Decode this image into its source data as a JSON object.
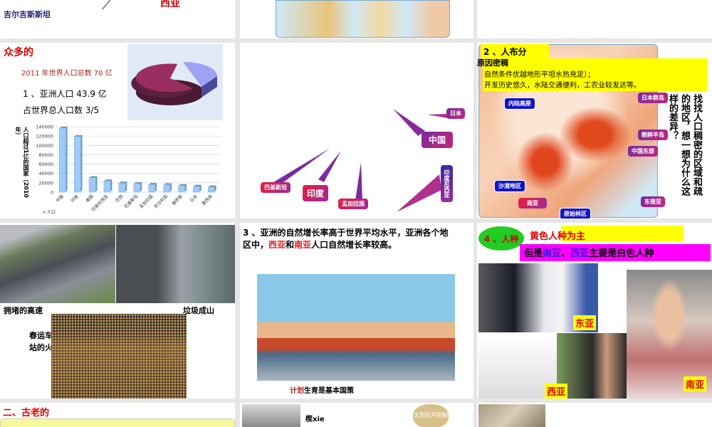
{
  "slide_top_left": {
    "label_kyrgyz": "吉尔吉斯斯坦",
    "label_red": "西亚"
  },
  "slide_pop": {
    "title": "众多的",
    "total": "2011 年世界人口总数 70 亿",
    "line1": "1 、亚洲人口 43.9 亿",
    "line2": "占世界总人口数 3/5"
  },
  "chart_data": {
    "type": "bar",
    "ylabel": "人口超过1亿的国家（2010年）",
    "categories": [
      "中国",
      "印度",
      "美国",
      "印度尼西亚",
      "巴西",
      "巴基斯坦",
      "孟加拉国",
      "尼日利亚",
      "俄罗斯",
      "日本",
      "墨西哥"
    ],
    "series": [
      {
        "name": "人口",
        "values": [
          137000,
          119000,
          31000,
          24000,
          19500,
          18500,
          16500,
          16000,
          14200,
          12700,
          11200
        ]
      }
    ],
    "ylim": [
      0,
      140000
    ],
    "yticks": [
      0,
      20000,
      40000,
      60000,
      80000,
      100000,
      120000,
      140000
    ],
    "grid": true,
    "legend": "bottom-left",
    "color": "#9ecbf5"
  },
  "slide_countries": {
    "labels": [
      "日本",
      "中国",
      "巴基斯坦",
      "印度",
      "孟加拉国",
      "印度尼西亚"
    ]
  },
  "slide_distribution": {
    "title": "2 、人布分",
    "sub": "原因密稠",
    "reason1": "自然条件优越地形平坦水热充足）；",
    "reason2": "开发历史悠久，水陆交通便利，工农业较发达等。",
    "regions_dense": [
      "日本群岛",
      "朝鲜半岛",
      "中国东部",
      "东南亚",
      "南亚"
    ],
    "regions_sparse": [
      "内陆高原",
      "沙漠地区",
      "原始林区"
    ],
    "question": "找找人口稠密的区域和疏的地区，想一想为什么这样的差异？"
  },
  "slide_problems": {
    "caption1": "拥堵的高速",
    "caption2": "垃圾成山",
    "caption3": "春运车站的火"
  },
  "slide_growth": {
    "t1": "3 、亚洲的自然增长率高于世界平均水平，亚洲各个地区中，",
    "west": "西亚",
    "and": "和",
    "south": "南亚",
    "t2": "人口自然增长率较高。",
    "caption_red": "计划",
    "caption_black": "生育是基本国策"
  },
  "slide_race": {
    "badge": "4 、人种",
    "title": "黄色人种为主",
    "sub1": "但是",
    "south": "南亚",
    "sep": "、",
    "west": "西亚",
    "sub2": "主要是白色人种",
    "labels": [
      "东亚",
      "西亚",
      "南亚"
    ]
  },
  "slide_bottom": {
    "title": "二、古老的",
    "wedge": "楔xie",
    "cloud": "太阴历月相制"
  }
}
